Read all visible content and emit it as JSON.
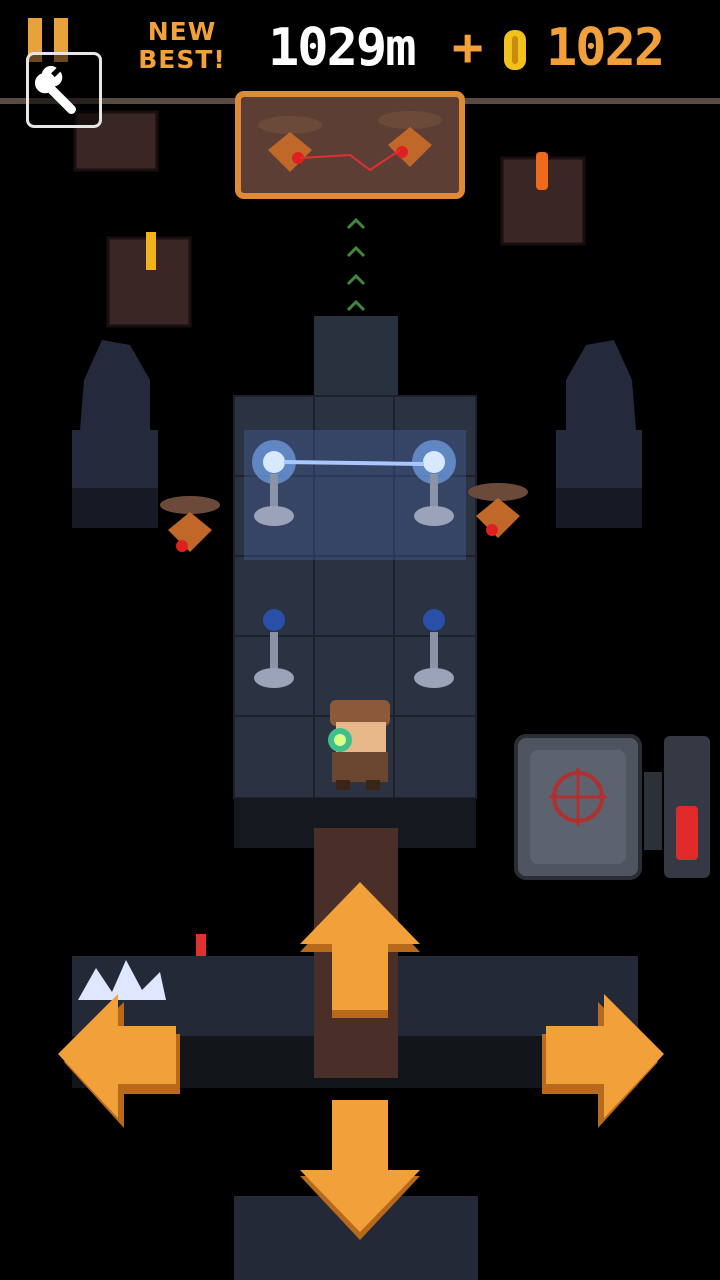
{
  "hud": {
    "new_best_line1": "NEW",
    "new_best_line2": "BEST!",
    "distance": "1029m",
    "plus": "+",
    "coins": "1022"
  },
  "icons": {
    "pause": "pause-icon",
    "settings": "wrench-icon",
    "coin": "coin-icon"
  },
  "controls": [
    "up",
    "left",
    "right",
    "down"
  ],
  "colors": {
    "accent": "#f2a03a",
    "arrow_dark": "#b86a1c",
    "floor": "#2a3140",
    "background": "#000000"
  }
}
